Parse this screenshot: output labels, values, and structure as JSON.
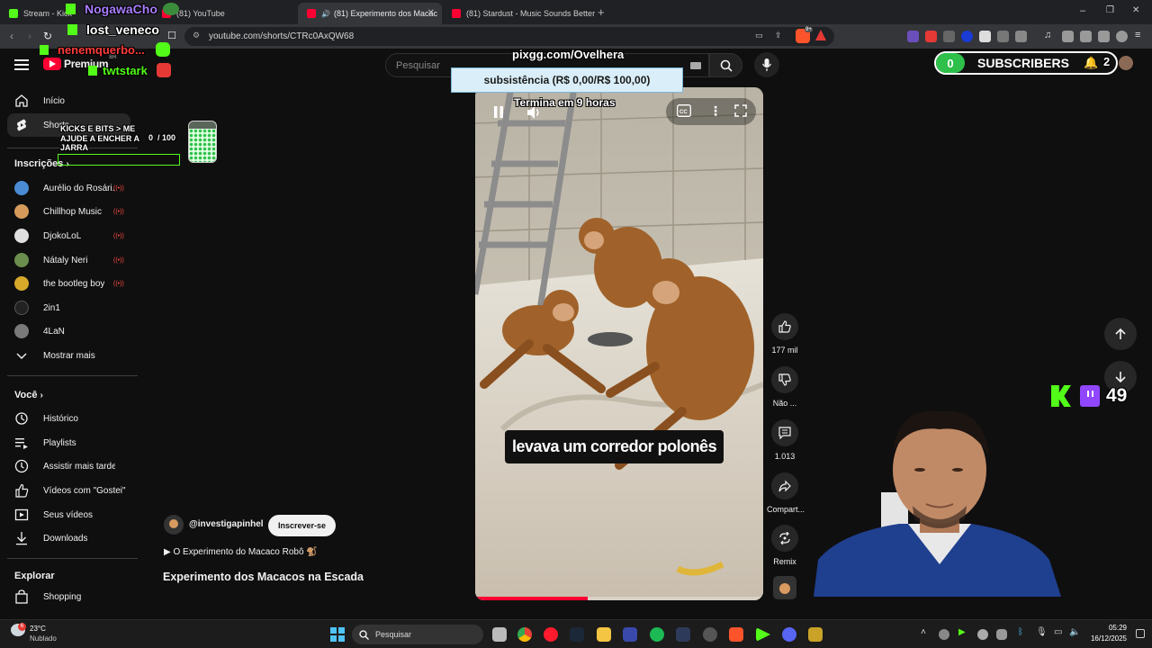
{
  "browser": {
    "tabs": [
      {
        "label": "Stream - Kick",
        "active": false
      },
      {
        "label": "(81) YouTube",
        "active": false
      },
      {
        "label": "(81) Experimento dos Macac",
        "active": true
      },
      {
        "label": "(81) Stardust - Music Sounds Better W",
        "active": false
      }
    ],
    "new_tab": "+",
    "url": "youtube.com/shorts/CTRc0AxQW68",
    "badge_count": "9+"
  },
  "youtube": {
    "logo_text": "Premium",
    "logo_region": "BR",
    "search_placeholder": "Pesquisar",
    "sidebar": {
      "main": [
        {
          "label": "Início",
          "icon": "home-icon"
        },
        {
          "label": "Shorts",
          "icon": "shorts-icon"
        }
      ],
      "subscriptions_title": "Inscrições",
      "subscriptions": [
        {
          "label": "Aurélio do Rosári...",
          "live": true,
          "color": "#4a8bd4"
        },
        {
          "label": "Chillhop Music",
          "live": true,
          "color": "#d69b5b"
        },
        {
          "label": "DjokoLoL",
          "live": true,
          "color": "#e0e0e0"
        },
        {
          "label": "Nátaly Neri",
          "live": true,
          "color": "#6b8e4e"
        },
        {
          "label": "the bootleg boy",
          "live": true,
          "color": "#d6a92b"
        },
        {
          "label": "2in1",
          "live": false,
          "color": "#222222"
        },
        {
          "label": "4LaN",
          "live": false,
          "color": "#7a7a7a"
        }
      ],
      "show_more": "Mostrar mais",
      "you_title": "Você",
      "you_items": [
        {
          "label": "Histórico",
          "icon": "history-icon"
        },
        {
          "label": "Playlists",
          "icon": "playlists-icon"
        },
        {
          "label": "Assistir mais tarde",
          "icon": "watch-later-icon"
        },
        {
          "label": "Vídeos com \"Gostei\"",
          "icon": "like-icon"
        },
        {
          "label": "Seus vídeos",
          "icon": "your-videos-icon"
        },
        {
          "label": "Downloads",
          "icon": "download-icon"
        }
      ],
      "explore_title": "Explorar",
      "explore_items": [
        {
          "label": "Shopping",
          "icon": "shopping-icon"
        }
      ]
    },
    "short": {
      "caption": "levava um corredor polonês",
      "channel": "@investigapinhel",
      "subscribe": "Inscrever-se",
      "playlist_title": "▶ O Experimento do Macaco Robô",
      "title": "Experimento dos Macacos na Escada",
      "progress": 0.39,
      "actions": {
        "likes": "177 mil",
        "dislike": "Não ...",
        "comments": "1.013",
        "share": "Compart...",
        "remix": "Remix"
      }
    }
  },
  "stream_overlay": {
    "chat": [
      {
        "user": "NogawaCho",
        "color": "#a97dff"
      },
      {
        "user": "lost_veneco",
        "color": "#ffffff"
      },
      {
        "user": "nenemquerbo...",
        "color": "#ff3b3b"
      },
      {
        "user": "twtstark",
        "color": "#53fc18"
      }
    ],
    "pix_url": "pixgg.com/Ovelhera",
    "goal_label": "subsistência (R$ 0,00/R$ 100,00)",
    "countdown": "Termina em 9 horas",
    "jar_text": "KICKS E BITS > ME AJUDE A ENCHER A JARRA",
    "jar_count": "0  / 100",
    "subscribers_label": "SUBSCRIBERS",
    "subscribers_count": "0",
    "notifications": "2",
    "viewer_count": "49"
  },
  "taskbar": {
    "temperature": "23°C",
    "weather": "Nublado",
    "search": "Pesquisar",
    "time": "05:29",
    "date": "16/12/2025"
  }
}
